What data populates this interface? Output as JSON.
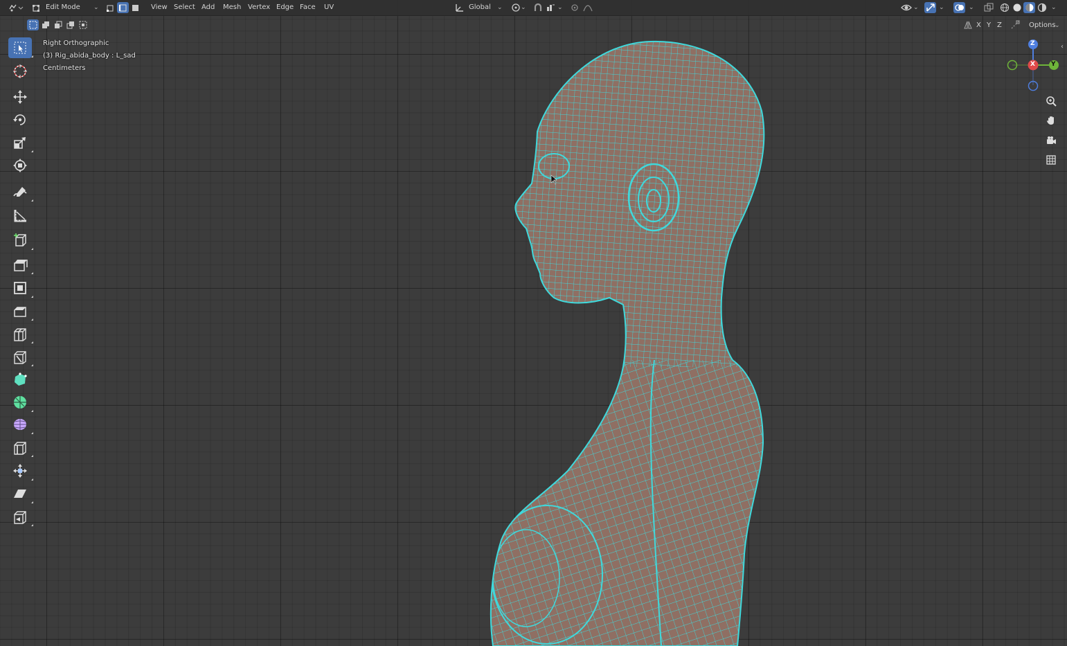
{
  "header": {
    "mode_label": "Edit Mode",
    "menus": [
      "View",
      "Select",
      "Add",
      "Mesh",
      "Vertex",
      "Edge",
      "Face",
      "UV"
    ],
    "transform_orientation": "Global",
    "options_label": "Options"
  },
  "subheader": {
    "axis_labels": [
      "X",
      "Y",
      "Z"
    ]
  },
  "viewport": {
    "view_name": "Right Orthographic",
    "object_info": "(3) Rig_abida_body : L_sad",
    "units": "Centimeters"
  },
  "gizmo": {
    "z": "Z",
    "x": "X",
    "y": "Y"
  },
  "colors": {
    "wire": "#3fd9dc",
    "mesh_fill": "#8f6f63",
    "active_blue": "#4772b3",
    "gizmo_x": "#e04a4a",
    "gizmo_y": "#6fb53a",
    "gizmo_z": "#4f7fe0"
  },
  "toolbar": {
    "tools": [
      "select-box",
      "cursor",
      "move",
      "rotate",
      "scale",
      "transform",
      "annotate",
      "measure",
      "add-cube",
      "extrude",
      "inset",
      "bevel",
      "loop-cut",
      "knife",
      "poly-build",
      "spin",
      "smooth",
      "edge-slide",
      "shrink-fatten",
      "shear",
      "rip-region"
    ]
  }
}
